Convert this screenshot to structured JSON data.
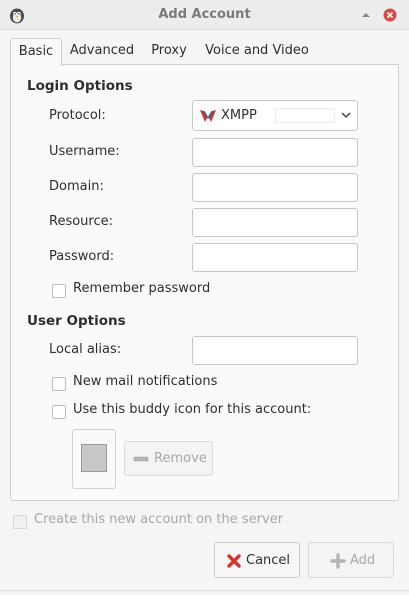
{
  "window": {
    "title": "Add Account",
    "icons": {
      "app": "pidgin-icon",
      "minimize": "minimize-icon",
      "close": "close-icon"
    },
    "close_color": "#d64a4a"
  },
  "tabs": [
    {
      "label": "Basic",
      "active": true
    },
    {
      "label": "Advanced",
      "active": false
    },
    {
      "label": "Proxy",
      "active": false
    },
    {
      "label": "Voice and Video",
      "active": false
    }
  ],
  "login_options": {
    "title": "Login Options",
    "protocol_label": "Protocol:",
    "protocol_value": "XMPP",
    "protocol_icon": "xmpp-icon",
    "username_label": "Username:",
    "username_value": "",
    "domain_label": "Domain:",
    "domain_value": "",
    "resource_label": "Resource:",
    "resource_value": "",
    "password_label": "Password:",
    "password_value": "",
    "remember_password_label": "Remember password",
    "remember_password_checked": false
  },
  "user_options": {
    "title": "User Options",
    "local_alias_label": "Local alias:",
    "local_alias_value": "",
    "new_mail_label": "New mail notifications",
    "new_mail_checked": false,
    "buddy_icon_label": "Use this buddy icon for this account:",
    "buddy_icon_checked": false,
    "remove_label": "Remove",
    "remove_icon": "remove-icon"
  },
  "create_on_server": {
    "label": "Create this new account on the server",
    "checked": false,
    "enabled": false
  },
  "buttons": {
    "cancel_label": "Cancel",
    "cancel_icon": "cancel-icon",
    "add_label": "Add",
    "add_icon": "add-icon"
  }
}
